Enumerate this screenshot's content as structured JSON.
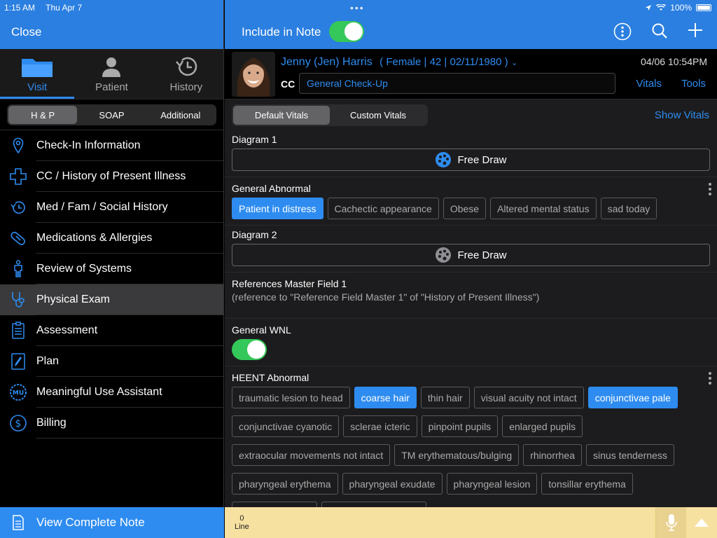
{
  "status": {
    "time": "1:15 AM",
    "date": "Thu Apr 7",
    "battery": "100%"
  },
  "left": {
    "close_label": "Close",
    "tabs": [
      {
        "label": "Visit",
        "icon": "folder-icon"
      },
      {
        "label": "Patient",
        "icon": "person-icon"
      },
      {
        "label": "History",
        "icon": "history-clock-icon"
      }
    ],
    "segments": [
      "H & P",
      "SOAP",
      "Additional"
    ],
    "nav": [
      {
        "label": "Check-In Information",
        "icon": "location-pin-icon"
      },
      {
        "label": "CC / History of Present Illness",
        "icon": "medical-cross-icon"
      },
      {
        "label": "Med / Fam / Social History",
        "icon": "history-clock-icon"
      },
      {
        "label": "Medications & Allergies",
        "icon": "pill-icon"
      },
      {
        "label": "Review of Systems",
        "icon": "body-icon"
      },
      {
        "label": "Physical Exam",
        "icon": "stethoscope-icon"
      },
      {
        "label": "Assessment",
        "icon": "checklist-icon"
      },
      {
        "label": "Plan",
        "icon": "pen-icon"
      },
      {
        "label": "Meaningful Use Assistant",
        "icon": "mu-badge-icon"
      },
      {
        "label": "Billing",
        "icon": "dollar-icon"
      }
    ],
    "view_note_label": "View Complete Note"
  },
  "right": {
    "include_label": "Include in Note",
    "patient": {
      "name": "Jenny (Jen) Harris",
      "demographics": "( Female | 42 | 02/11/1980 )",
      "datetime": "04/06 10:54PM",
      "cc_label": "CC",
      "cc_value": "General Check-Up",
      "vitals_link": "Vitals",
      "tools_link": "Tools"
    },
    "vitals_tabs": [
      "Default Vitals",
      "Custom Vitals"
    ],
    "show_vitals": "Show Vitals",
    "diagram1": {
      "title": "Diagram 1",
      "button": "Free Draw"
    },
    "general_abnormal": {
      "title": "General Abnormal",
      "chips": [
        {
          "label": "Patient in distress",
          "selected": true
        },
        {
          "label": "Cachectic appearance",
          "selected": false
        },
        {
          "label": "Obese",
          "selected": false
        },
        {
          "label": "Altered mental status",
          "selected": false
        },
        {
          "label": "sad today",
          "selected": false
        }
      ]
    },
    "diagram2": {
      "title": "Diagram 2",
      "button": "Free Draw"
    },
    "reference": {
      "title": "References Master Field 1",
      "text": "(reference to \"Reference Field Master 1\" of \"History of Present Illness\")"
    },
    "general_wnl": {
      "title": "General WNL"
    },
    "heent": {
      "title": "HEENT Abnormal",
      "chips": [
        {
          "label": "traumatic lesion to head",
          "selected": false
        },
        {
          "label": "coarse hair",
          "selected": true
        },
        {
          "label": "thin hair",
          "selected": false
        },
        {
          "label": "visual acuity not intact",
          "selected": false
        },
        {
          "label": "conjunctivae pale",
          "selected": true
        },
        {
          "label": "conjunctivae cyanotic",
          "selected": false
        },
        {
          "label": "sclerae icteric",
          "selected": false
        },
        {
          "label": "pinpoint pupils",
          "selected": false
        },
        {
          "label": "enlarged pupils",
          "selected": false
        },
        {
          "label": "extraocular movements not intact",
          "selected": false
        },
        {
          "label": "TM erythematous/bulging",
          "selected": false
        },
        {
          "label": "rhinorrhea",
          "selected": false
        },
        {
          "label": "sinus tenderness",
          "selected": false
        },
        {
          "label": "pharyngeal erythema",
          "selected": false
        },
        {
          "label": "pharyngeal exudate",
          "selected": false
        },
        {
          "label": "pharyngeal lesion",
          "selected": false
        },
        {
          "label": "tonsillar erythema",
          "selected": false
        },
        {
          "label": "tonsillar exudate",
          "selected": false
        },
        {
          "label": "tonsillar enlargement",
          "selected": false
        }
      ]
    },
    "bottom": {
      "line_count": "0",
      "line_label": "Line"
    }
  },
  "colors": {
    "accent": "#2e8cf0",
    "header": "#2b7fe0",
    "toggle_on": "#34c759",
    "bottom_bar": "#f7e1a0"
  }
}
